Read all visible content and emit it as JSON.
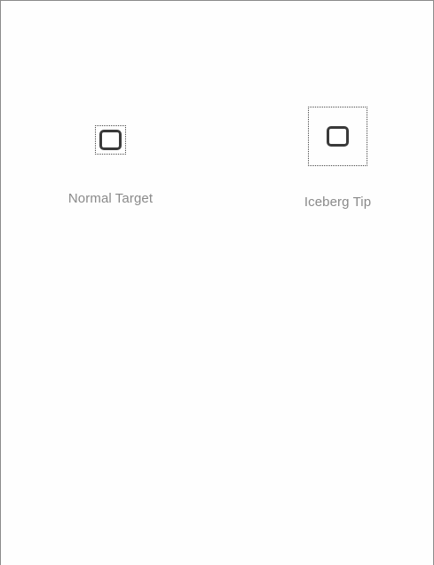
{
  "targets": {
    "normal": {
      "label": "Normal Target",
      "icon": "rounded-square-icon"
    },
    "iceberg": {
      "label": "Iceberg Tip",
      "icon": "rounded-square-icon"
    }
  },
  "colors": {
    "background": "#fefefe",
    "glyph_stroke": "#3a3a3a",
    "hit_area_border": "#4a4a4a",
    "label_text": "#8a8a8a",
    "frame_border": "#8c8c8c"
  }
}
